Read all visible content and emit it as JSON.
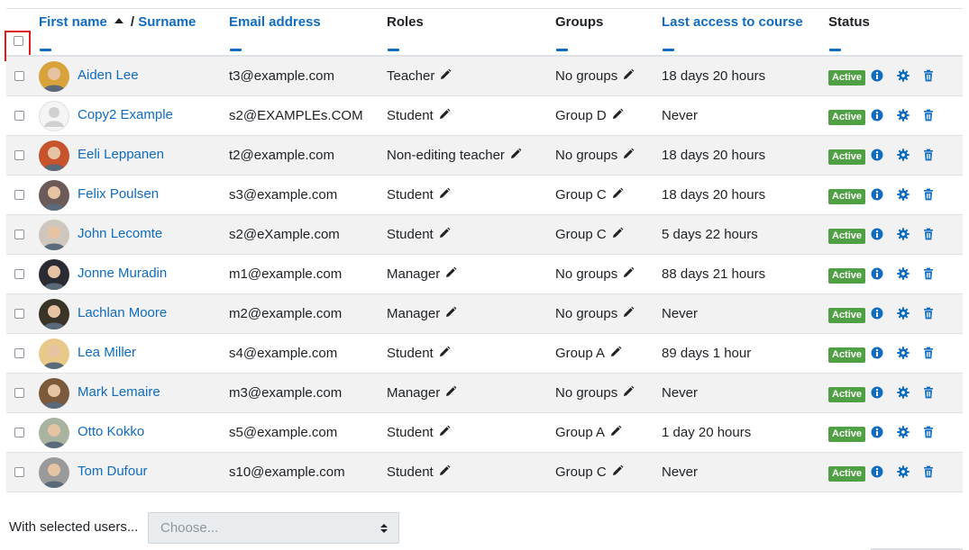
{
  "header": {
    "first_name": "First name",
    "slash": "/",
    "surname": "Surname",
    "email": "Email address",
    "roles": "Roles",
    "groups": "Groups",
    "last_access": "Last access to course",
    "status": "Status"
  },
  "rows": [
    {
      "name": "Aiden Lee",
      "email": "t3@example.com",
      "role": "Teacher",
      "group": "No groups",
      "last_access": "18 days 20 hours",
      "status": "Active",
      "avatar_color": "#d9a33b"
    },
    {
      "name": "Copy2 Example",
      "email": "s2@EXAMPLEs.COM",
      "role": "Student",
      "group": "Group D",
      "last_access": "Never",
      "status": "Active",
      "avatar_color": "#f0f0f0"
    },
    {
      "name": "Eeli Leppanen",
      "email": "t2@example.com",
      "role": "Non-editing teacher",
      "group": "No groups",
      "last_access": "18 days 20 hours",
      "status": "Active",
      "avatar_color": "#c6532c"
    },
    {
      "name": "Felix Poulsen",
      "email": "s3@example.com",
      "role": "Student",
      "group": "Group C",
      "last_access": "18 days 20 hours",
      "status": "Active",
      "avatar_color": "#6b5a58"
    },
    {
      "name": "John Lecomte",
      "email": "s2@eXample.com",
      "role": "Student",
      "group": "Group C",
      "last_access": "5 days 22 hours",
      "status": "Active",
      "avatar_color": "#cfc6bd"
    },
    {
      "name": "Jonne Muradin",
      "email": "m1@example.com",
      "role": "Manager",
      "group": "No groups",
      "last_access": "88 days 21 hours",
      "status": "Active",
      "avatar_color": "#2b2b33"
    },
    {
      "name": "Lachlan Moore",
      "email": "m2@example.com",
      "role": "Manager",
      "group": "No groups",
      "last_access": "Never",
      "status": "Active",
      "avatar_color": "#3a3328"
    },
    {
      "name": "Lea Miller",
      "email": "s4@example.com",
      "role": "Student",
      "group": "Group A",
      "last_access": "89 days 1 hour",
      "status": "Active",
      "avatar_color": "#e8c98a"
    },
    {
      "name": "Mark Lemaire",
      "email": "m3@example.com",
      "role": "Manager",
      "group": "No groups",
      "last_access": "Never",
      "status": "Active",
      "avatar_color": "#7a5a3a"
    },
    {
      "name": "Otto Kokko",
      "email": "s5@example.com",
      "role": "Student",
      "group": "Group A",
      "last_access": "1 day 20 hours",
      "status": "Active",
      "avatar_color": "#a9b4a0"
    },
    {
      "name": "Tom Dufour",
      "email": "s10@example.com",
      "role": "Student",
      "group": "Group C",
      "last_access": "Never",
      "status": "Active",
      "avatar_color": "#9a9a9a"
    }
  ],
  "footer": {
    "with_selected": "With selected users...",
    "choose_placeholder": "Choose..."
  },
  "colors": {
    "link": "#0f6cbf",
    "active_badge": "#4fa044",
    "highlight_box": "#e0191b"
  },
  "icons": {
    "row_actions": [
      "info-icon",
      "gear-icon",
      "trash-icon"
    ],
    "edit": "pencil-icon",
    "sort": "sort-ascending-icon"
  }
}
